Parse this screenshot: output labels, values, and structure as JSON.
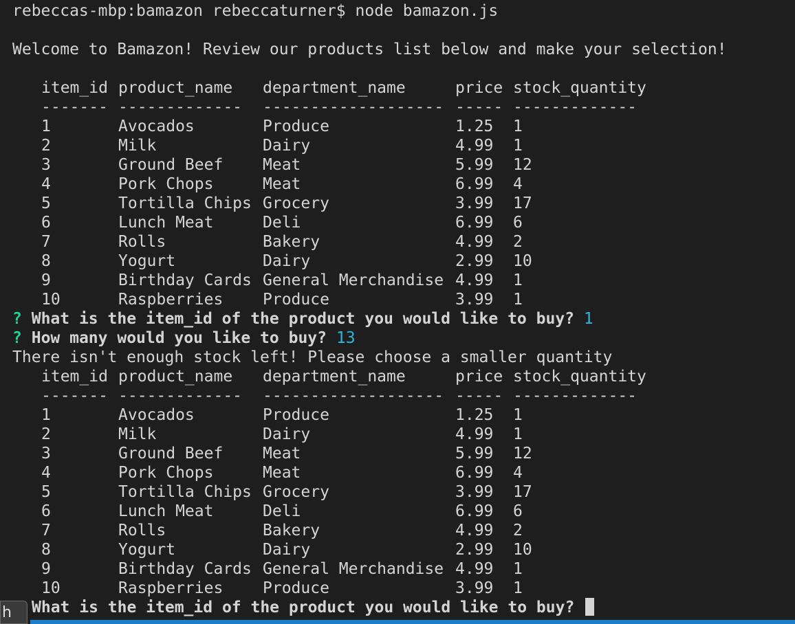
{
  "command_line": "rebeccas-mbp:bamazon rebeccaturner$ node bamazon.js",
  "welcome": "Welcome to Bamazon! Review our products list below and make your selection!",
  "table": {
    "headers": [
      "item_id",
      "product_name",
      "department_name",
      "price",
      "stock_quantity"
    ],
    "separators": [
      "-------",
      "-------------",
      "-------------------",
      "-----",
      "-------------"
    ],
    "rows": [
      [
        "1",
        "Avocados",
        "Produce",
        "1.25",
        "1"
      ],
      [
        "2",
        "Milk",
        "Dairy",
        "4.99",
        "1"
      ],
      [
        "3",
        "Ground Beef",
        "Meat",
        "5.99",
        "12"
      ],
      [
        "4",
        "Pork Chops",
        "Meat",
        "6.99",
        "4"
      ],
      [
        "5",
        "Tortilla Chips",
        "Grocery",
        "3.99",
        "17"
      ],
      [
        "6",
        "Lunch Meat",
        "Deli",
        "6.99",
        "6"
      ],
      [
        "7",
        "Rolls",
        "Bakery",
        "4.99",
        "2"
      ],
      [
        "8",
        "Yogurt",
        "Dairy",
        "2.99",
        "10"
      ],
      [
        "9",
        "Birthday Cards",
        "General Merchandise",
        "4.99",
        "1"
      ],
      [
        "10",
        "Raspberries",
        "Produce",
        "3.99",
        "1"
      ]
    ]
  },
  "prompt1": {
    "marker": "?",
    "question": "What is the item_id of the product you would like to buy?",
    "answer": "1"
  },
  "prompt2": {
    "marker": "?",
    "question": "How many would you like to buy?",
    "answer": "13"
  },
  "error_message": "There isn't enough stock left! Please choose a smaller quantity",
  "prompt3": {
    "question": "What is the item_id of the product you would like to buy?"
  },
  "sidebar_tab_label": "h",
  "colors": {
    "background": "#1e1e1e",
    "text": "#d4d4d4",
    "prompt_marker": "#23d18b",
    "answer": "#29b8db",
    "status_bar": "#1e7ec8"
  }
}
